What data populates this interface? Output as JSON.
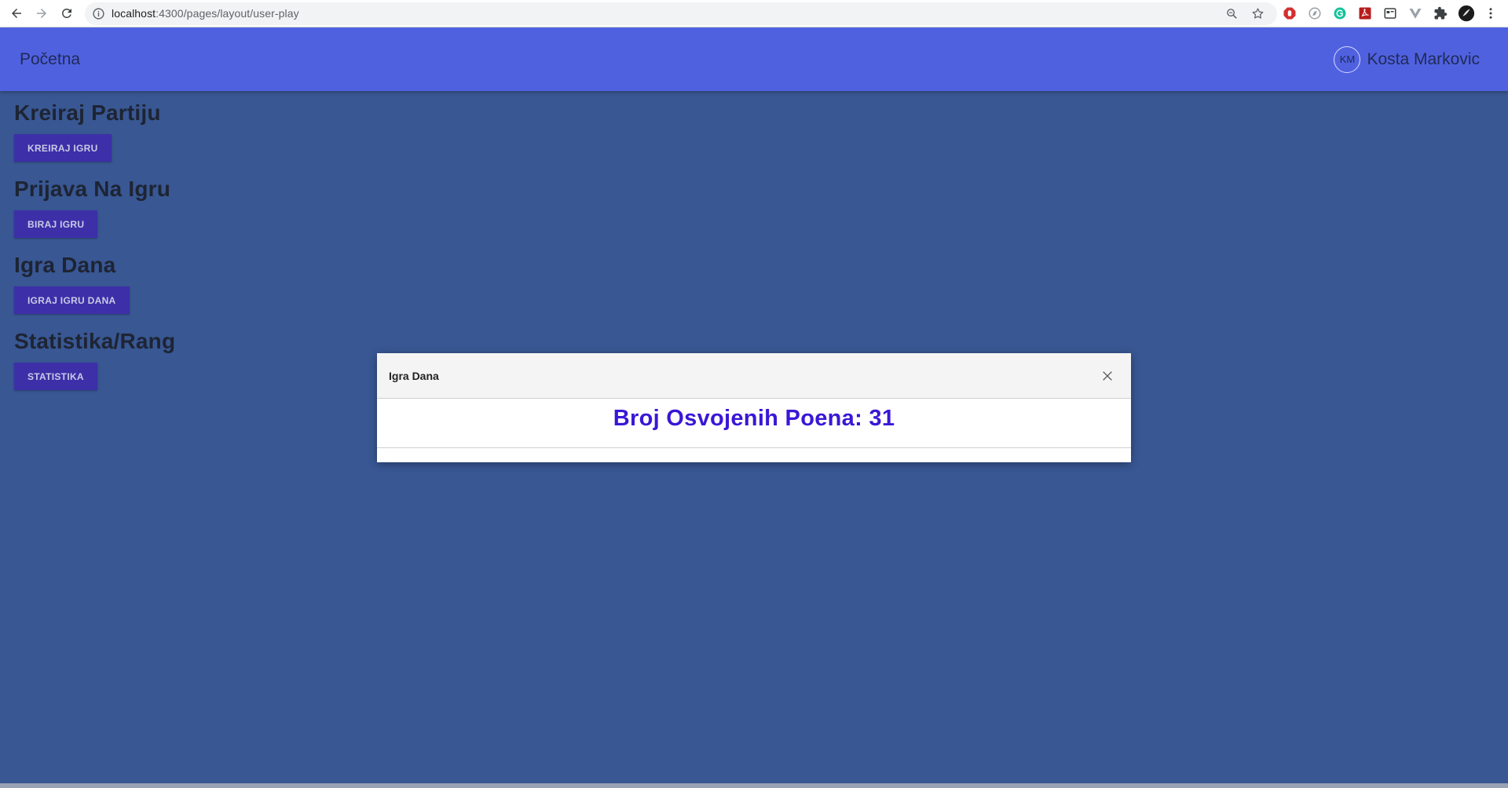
{
  "browser": {
    "url_host": "localhost",
    "url_path": ":4300/pages/layout/user-play",
    "icons": [
      "back-icon",
      "forward-icon",
      "reload-icon",
      "site-info-icon",
      "zoom-icon",
      "bookmark-star-icon"
    ],
    "extensions": [
      "adblock-icon",
      "compass-icon",
      "grammarly-icon",
      "pdf-icon",
      "wappalyzer-icon",
      "vue-devtools-icon",
      "extensions-puzzle-icon",
      "profile-icon",
      "menu-dots-icon"
    ]
  },
  "header": {
    "brand": "Početna",
    "user_initials": "KM",
    "user_name": "Kosta Markovic",
    "bg_color": "#5061e0"
  },
  "sections": [
    {
      "title": "Kreiraj Partiju",
      "button": "KREIRAJ IGRU"
    },
    {
      "title": "Prijava Na Igru",
      "button": "BIRAJ IGRU"
    },
    {
      "title": "Igra Dana",
      "button": "IGRAJ IGRU DANA"
    },
    {
      "title": "Statistika/Rang",
      "button": "STATISTIKA"
    }
  ],
  "modal": {
    "title": "Igra Dana",
    "score_text": "Broj Osvojenih Poena: 31",
    "close_icon": "close-icon"
  },
  "colors": {
    "page_bg": "#385793",
    "button_bg": "#3d2fa8",
    "score_color": "#3a17d6"
  }
}
